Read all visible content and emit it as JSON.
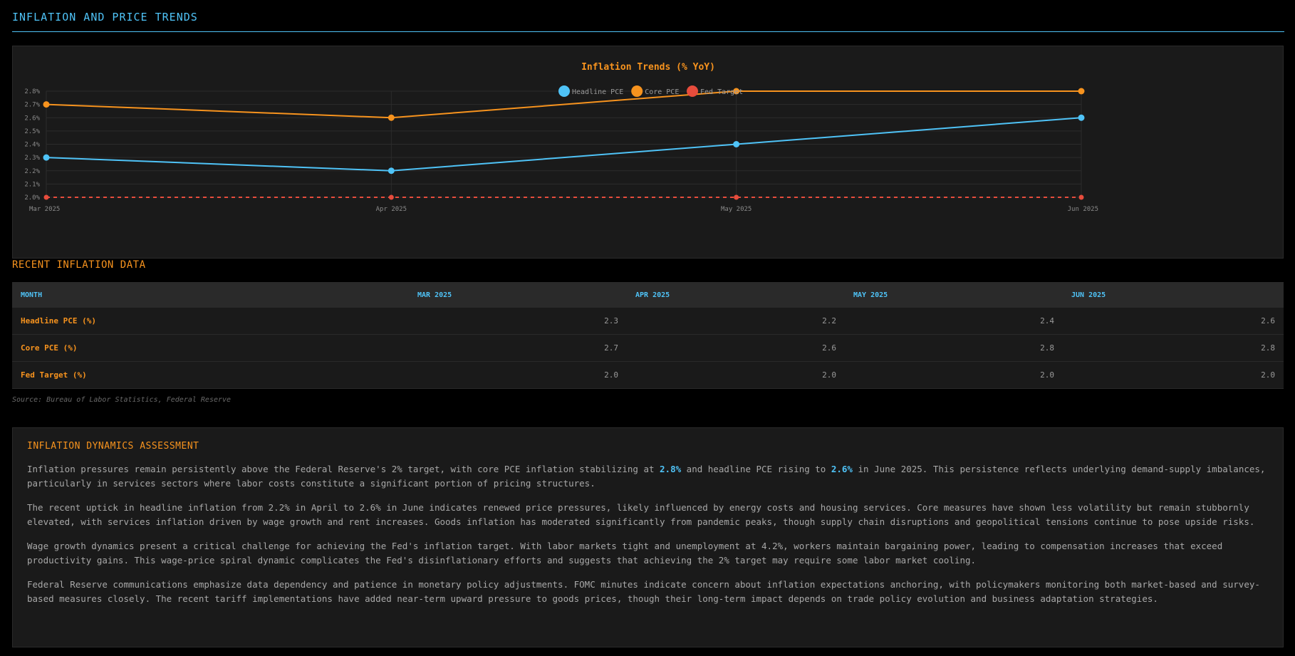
{
  "header": {
    "title": "INFLATION AND PRICE TRENDS"
  },
  "chart_data": {
    "type": "line",
    "title": "Inflation Trends (% YoY)",
    "x": [
      "Mar 2025",
      "Apr 2025",
      "May 2025",
      "Jun 2025"
    ],
    "series": [
      {
        "name": "Headline PCE",
        "values": [
          2.3,
          2.2,
          2.4,
          2.6
        ],
        "color": "#4fc3f7",
        "dashed": false
      },
      {
        "name": "Core PCE",
        "values": [
          2.7,
          2.6,
          2.8,
          2.8
        ],
        "color": "#f7931e",
        "dashed": false
      },
      {
        "name": "Fed Target",
        "values": [
          2.0,
          2.0,
          2.0,
          2.0
        ],
        "color": "#e74c3c",
        "dashed": true
      }
    ],
    "ylim": [
      2.0,
      2.8
    ],
    "yticks": [
      "2.0%",
      "2.1%",
      "2.2%",
      "2.3%",
      "2.4%",
      "2.5%",
      "2.6%",
      "2.7%",
      "2.8%"
    ],
    "legend": "top-center",
    "grid": true
  },
  "table": {
    "title": "RECENT INFLATION DATA",
    "headers": [
      "MONTH",
      "MAR 2025",
      "APR 2025",
      "MAY 2025",
      "JUN 2025"
    ],
    "rows": [
      {
        "label": "Headline PCE (%)",
        "values": [
          "2.3",
          "2.2",
          "2.4",
          "2.6"
        ]
      },
      {
        "label": "Core PCE (%)",
        "values": [
          "2.7",
          "2.6",
          "2.8",
          "2.8"
        ]
      },
      {
        "label": "Fed Target (%)",
        "values": [
          "2.0",
          "2.0",
          "2.0",
          "2.0"
        ]
      }
    ],
    "source": "Source: Bureau of Labor Statistics, Federal Reserve"
  },
  "analysis": {
    "title": "INFLATION DYNAMICS ASSESSMENT",
    "p1_a": "Inflation pressures remain persistently above the Federal Reserve's 2% target, with core PCE inflation stabilizing at ",
    "p1_hl1": "2.8%",
    "p1_b": " and headline PCE rising to ",
    "p1_hl2": "2.6%",
    "p1_c": " in June 2025. This persistence reflects underlying demand-supply imbalances, particularly in services sectors where labor costs constitute a significant portion of pricing structures.",
    "p2": "The recent uptick in headline inflation from 2.2% in April to 2.6% in June indicates renewed price pressures, likely influenced by energy costs and housing services. Core measures have shown less volatility but remain stubbornly elevated, with services inflation driven by wage growth and rent increases. Goods inflation has moderated significantly from pandemic peaks, though supply chain disruptions and geopolitical tensions continue to pose upside risks.",
    "p3": "Wage growth dynamics present a critical challenge for achieving the Fed's inflation target. With labor markets tight and unemployment at 4.2%, workers maintain bargaining power, leading to compensation increases that exceed productivity gains. This wage-price spiral dynamic complicates the Fed's disinflationary efforts and suggests that achieving the 2% target may require some labor market cooling.",
    "p4": "Federal Reserve communications emphasize data dependency and patience in monetary policy adjustments. FOMC minutes indicate concern about inflation expectations anchoring, with policymakers monitoring both market-based and survey-based measures closely. The recent tariff implementations have added near-term upward pressure to goods prices, though their long-term impact depends on trade policy evolution and business adaptation strategies."
  }
}
